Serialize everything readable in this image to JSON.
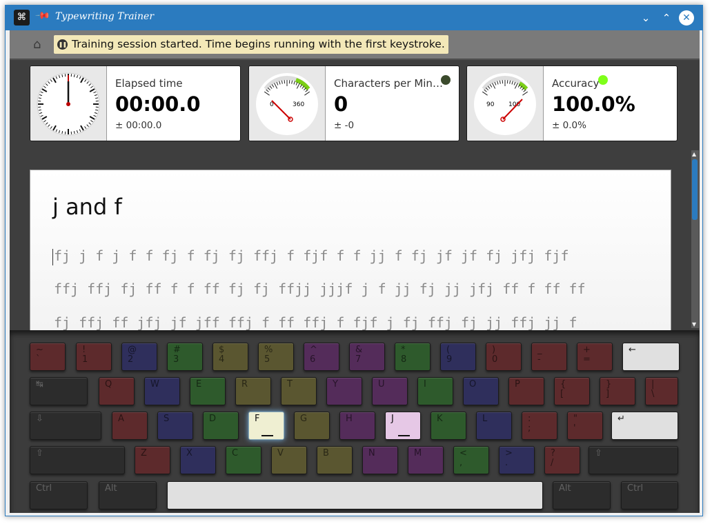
{
  "window": {
    "title": "Typewriting Trainer"
  },
  "toolbar": {
    "notice": "Training session started. Time begins running with the first keystroke."
  },
  "stats": {
    "elapsed": {
      "label": "Elapsed time",
      "value": "00:00.0",
      "delta": "± 00:00.0"
    },
    "cpm": {
      "label": "Characters per Min…",
      "value": "0",
      "delta": "± -0",
      "gauge_min": "0",
      "gauge_max": "360",
      "indicator_color": "#3b4a2c"
    },
    "accuracy": {
      "label": "Accuracy",
      "value": "100.0%",
      "delta": "± 0.0%",
      "gauge_min": "90",
      "gauge_max": "100",
      "indicator_color": "#7fff1a"
    }
  },
  "lesson": {
    "title": "j and f",
    "lines": [
      "fj j f j f f fj f fj fj ffj f fjf f f jj f fj jf jf fj jfj fjf",
      "ffj ffj fj ff f f ff fj fj ffjj jjjf j f jj fj jj jfj ff f ff ff",
      "fj ffj ff jfj jf jff ffj f ff ffj f fjf j fj ffj fj jj ffj jj f"
    ]
  },
  "keyboard": {
    "rows": [
      [
        {
          "top": "~",
          "bot": "`",
          "color": "red"
        },
        {
          "top": "!",
          "bot": "1",
          "color": "red"
        },
        {
          "top": "@",
          "bot": "2",
          "color": "blue"
        },
        {
          "top": "#",
          "bot": "3",
          "color": "green"
        },
        {
          "top": "$",
          "bot": "4",
          "color": "yellow"
        },
        {
          "top": "%",
          "bot": "5",
          "color": "yellow"
        },
        {
          "top": "^",
          "bot": "6",
          "color": "purple"
        },
        {
          "top": "&",
          "bot": "7",
          "color": "purple"
        },
        {
          "top": "*",
          "bot": "8",
          "color": "green"
        },
        {
          "top": "(",
          "bot": "9",
          "color": "blue"
        },
        {
          "top": ")",
          "bot": "0",
          "color": "red"
        },
        {
          "top": "_",
          "bot": "-",
          "color": "red"
        },
        {
          "top": "+",
          "bot": "=",
          "color": "red"
        },
        {
          "top": "←",
          "bot": "",
          "color": "light"
        }
      ],
      [
        {
          "top": "↹",
          "bot": "",
          "color": "dark"
        },
        {
          "top": "Q",
          "bot": "",
          "color": "red"
        },
        {
          "top": "W",
          "bot": "",
          "color": "blue"
        },
        {
          "top": "E",
          "bot": "",
          "color": "green"
        },
        {
          "top": "R",
          "bot": "",
          "color": "yellow"
        },
        {
          "top": "T",
          "bot": "",
          "color": "yellow"
        },
        {
          "top": "Y",
          "bot": "",
          "color": "purple"
        },
        {
          "top": "U",
          "bot": "",
          "color": "purple"
        },
        {
          "top": "I",
          "bot": "",
          "color": "green"
        },
        {
          "top": "O",
          "bot": "",
          "color": "blue"
        },
        {
          "top": "P",
          "bot": "",
          "color": "red"
        },
        {
          "top": "{",
          "bot": "[",
          "color": "red"
        },
        {
          "top": "}",
          "bot": "]",
          "color": "red"
        },
        {
          "top": "|",
          "bot": "\\",
          "color": "red"
        }
      ],
      [
        {
          "top": "⇩",
          "bot": "",
          "color": "dark"
        },
        {
          "top": "A",
          "bot": "",
          "color": "red"
        },
        {
          "top": "S",
          "bot": "",
          "color": "blue"
        },
        {
          "top": "D",
          "bot": "",
          "color": "green"
        },
        {
          "top": "F",
          "bot": "",
          "color": "fhl"
        },
        {
          "top": "G",
          "bot": "",
          "color": "yellow"
        },
        {
          "top": "H",
          "bot": "",
          "color": "purple"
        },
        {
          "top": "J",
          "bot": "",
          "color": "jhl"
        },
        {
          "top": "K",
          "bot": "",
          "color": "green"
        },
        {
          "top": "L",
          "bot": "",
          "color": "blue"
        },
        {
          "top": ":",
          "bot": ";",
          "color": "red"
        },
        {
          "top": "\"",
          "bot": "'",
          "color": "red"
        },
        {
          "top": "↵",
          "bot": "",
          "color": "light"
        }
      ],
      [
        {
          "top": "⇧",
          "bot": "",
          "color": "dark"
        },
        {
          "top": "Z",
          "bot": "",
          "color": "red"
        },
        {
          "top": "X",
          "bot": "",
          "color": "blue"
        },
        {
          "top": "C",
          "bot": "",
          "color": "green"
        },
        {
          "top": "V",
          "bot": "",
          "color": "yellow"
        },
        {
          "top": "B",
          "bot": "",
          "color": "yellow"
        },
        {
          "top": "N",
          "bot": "",
          "color": "purple"
        },
        {
          "top": "M",
          "bot": "",
          "color": "purple"
        },
        {
          "top": "<",
          "bot": ",",
          "color": "green"
        },
        {
          "top": ">",
          "bot": ".",
          "color": "blue"
        },
        {
          "top": "?",
          "bot": "/",
          "color": "red"
        },
        {
          "top": "⇧",
          "bot": "",
          "color": "dark"
        }
      ],
      [
        {
          "top": "Ctrl",
          "bot": "",
          "color": "dark"
        },
        {
          "top": "Alt",
          "bot": "",
          "color": "dark"
        },
        {
          "top": "",
          "bot": "",
          "color": "light"
        },
        {
          "top": "Alt",
          "bot": "",
          "color": "dark"
        },
        {
          "top": "Ctrl",
          "bot": "",
          "color": "dark"
        }
      ]
    ]
  }
}
